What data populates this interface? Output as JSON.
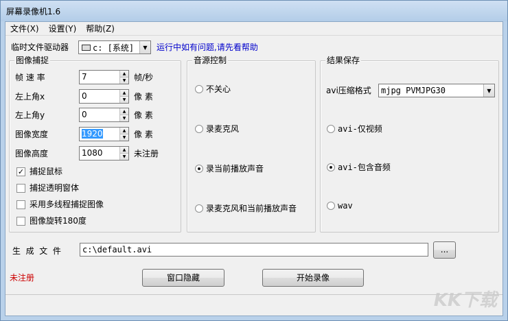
{
  "window": {
    "title": "屏幕录像机1.6"
  },
  "menu": {
    "file": "文件(X)",
    "settings": "设置(Y)",
    "help": "帮助(Z)"
  },
  "temp_drive": {
    "label": "临时文件驱动器",
    "value": "c: [系统]",
    "help_link": "运行中如有问题,请先看帮助"
  },
  "capture": {
    "title": "图像捕捉",
    "fields": [
      {
        "label": "帧 速 率",
        "value": "7",
        "unit": "帧/秒"
      },
      {
        "label": "左上角x",
        "value": "0",
        "unit": "像  素"
      },
      {
        "label": "左上角y",
        "value": "0",
        "unit": "像  素"
      },
      {
        "label": "图像宽度",
        "value": "1920",
        "unit": "像  素"
      },
      {
        "label": "图像高度",
        "value": "1080",
        "unit": "未注册"
      }
    ],
    "checks": [
      {
        "label": "捕捉鼠标",
        "checked": true
      },
      {
        "label": "捕捉透明窗体",
        "checked": false
      },
      {
        "label": "采用多线程捕捉图像",
        "checked": false
      },
      {
        "label": "图像旋转180度",
        "checked": false
      }
    ]
  },
  "audio": {
    "title": "音源控制",
    "options": [
      {
        "label": "不关心",
        "selected": false
      },
      {
        "label": "录麦克风",
        "selected": false
      },
      {
        "label": "录当前播放声音",
        "selected": true
      },
      {
        "label": "录麦克风和当前播放声音",
        "selected": false
      }
    ]
  },
  "output": {
    "title": "结果保存",
    "codec_label": "avi压缩格式",
    "codec_value": "mjpg PVMJPG30",
    "options": [
      {
        "label": "avi-仅视频",
        "selected": false
      },
      {
        "label": "avi-包含音频",
        "selected": true
      },
      {
        "label": "wav",
        "selected": false
      }
    ]
  },
  "file": {
    "label": "生  成  文  件",
    "value": "c:\\default.avi",
    "browse": "..."
  },
  "footer": {
    "unregistered": "未注册",
    "hide_button": "窗口隐藏",
    "start_button": "开始录像",
    "watermark": "KK下载"
  },
  "colors": {
    "link": "#0000cc",
    "warning": "#cc0000"
  }
}
